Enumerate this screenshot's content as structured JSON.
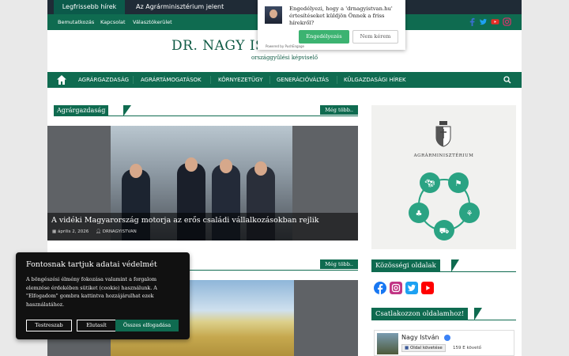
{
  "ticker": {
    "label": "Legfrissebb hírek",
    "text": "Az Agrárminisztérium jelent"
  },
  "subnav": {
    "items": [
      "Bemutatkozás",
      "Kapcsolat",
      "Választókerület"
    ]
  },
  "header": {
    "title": "DR. NAGY ISTVÁN MINISZTER",
    "subtitle": "országgyűlési képviselő"
  },
  "mainmenu": {
    "items": [
      "AGRÁRGAZDASÁG",
      "AGRÁRTÁMOGATÁSOK",
      "KÖRNYEZETÜGY",
      "GENERÁCIÓVÁLTÁS",
      "KÜLGAZDASÁGI HÍREK"
    ]
  },
  "section1": {
    "title": "Agrárgazdaság",
    "more": "Még több.."
  },
  "feature": {
    "title": "A vidéki Magyarország motorja az erős családi vállalkozásokban rejlik",
    "date": "április 2, 2026",
    "author": "DRNAGYISTVAN"
  },
  "section2": {
    "more": "Még több.."
  },
  "sidebar": {
    "ministry_name": "AGRÁRMINISZTÉRIUM",
    "community_title": "Közösségi oldalak",
    "join_title": "Csatlakozzon oldalamhoz!",
    "fb_name": "Nagy István",
    "fb_follow": "Oldal követése",
    "fb_count": "159 E követő"
  },
  "notification": {
    "message": "Engedélyezi, hogy a 'drnagyistvan.hu' értesítéseket küldjön Önnek a friss hírekről?",
    "allow": "Engedélyezés",
    "deny": "Nem kérem",
    "powered": "Powered by PushEngage"
  },
  "cookie": {
    "title": "Fontosnak tartjuk adatai védelmét",
    "text": "A böngészési élmény fokozása valamint a forgalom elemzése érdekében sütiket (cookie) használunk. A \"Elfogadom\" gombra kattintva hozzájárulhat ezek használatához.",
    "settings": "Testreszab",
    "reject": "Elutasít",
    "accept": "Összes elfogadása"
  },
  "colors": {
    "brand_green": "#0f6b50",
    "dark_bar": "#1f2b36",
    "facebook": "#3b5998",
    "instagram": "#c13584",
    "twitter": "#1da1f2",
    "youtube": "#ff0000"
  },
  "icons": [
    "facebook-icon",
    "twitter-icon",
    "youtube-icon",
    "instagram-icon",
    "home-icon",
    "search-icon",
    "calendar-icon",
    "user-icon",
    "hungarian-coat-of-arms",
    "cow-icon",
    "tractor-icon",
    "wheat-icon",
    "tree-icon"
  ]
}
